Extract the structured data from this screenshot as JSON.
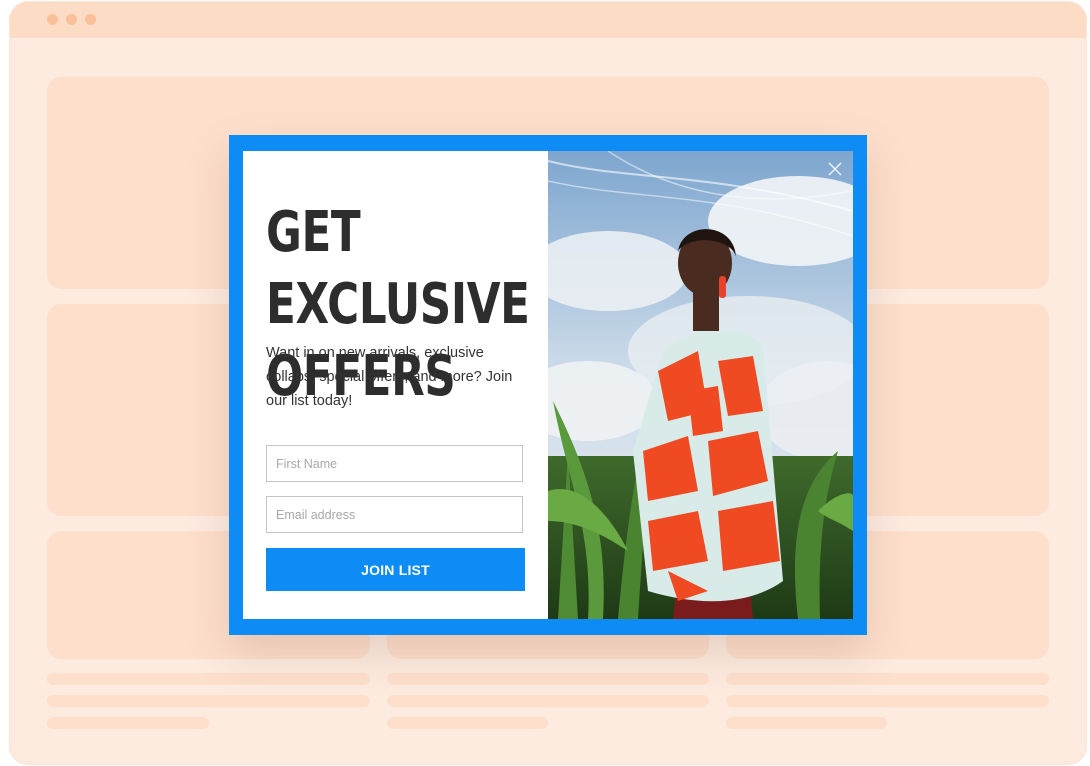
{
  "window": {
    "controls": [
      "dot-red",
      "dot-yellow",
      "dot-green"
    ]
  },
  "popup": {
    "headline": "GET EXCLUSIVE\nOFFERS",
    "description": "Want in on new arrivals, exclusive collabs, special offers, and more? Join our list today!",
    "first_name_placeholder": "First Name",
    "email_placeholder": "Email address",
    "submit_label": "JOIN LIST",
    "close_icon": "close-icon"
  },
  "colors": {
    "accent": "#0d8cf5",
    "page_background": "#fdebe0",
    "placeholder_block": "#fddfcc",
    "headline_text": "#2d2d2d"
  }
}
